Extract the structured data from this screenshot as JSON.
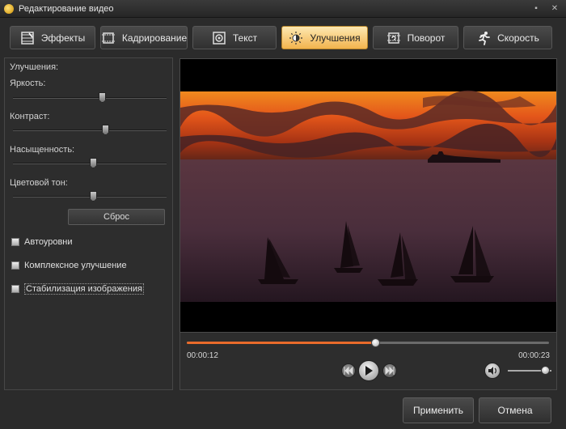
{
  "window": {
    "title": "Редактирование видео",
    "app_icon": "app-logo-icon"
  },
  "tabs": [
    {
      "label": "Эффекты",
      "icon": "effects-icon",
      "active": false
    },
    {
      "label": "Кадрирование",
      "icon": "crop-icon",
      "active": false
    },
    {
      "label": "Текст",
      "icon": "text-icon",
      "active": false
    },
    {
      "label": "Улучшения",
      "icon": "enhance-sun-icon",
      "active": true
    },
    {
      "label": "Поворот",
      "icon": "rotate-icon",
      "active": false
    },
    {
      "label": "Скорость",
      "icon": "running-man-icon",
      "active": false
    }
  ],
  "enhance": {
    "section_title": "Улучшения:",
    "sliders": [
      {
        "label": "Яркость:",
        "value": 0.58
      },
      {
        "label": "Контраст:",
        "value": 0.6
      },
      {
        "label": "Насыщенность:",
        "value": 0.52
      },
      {
        "label": "Цветовой тон:",
        "value": 0.52
      }
    ],
    "reset_label": "Сброс",
    "checkboxes": [
      {
        "label": "Автоуровни",
        "checked": false
      },
      {
        "label": "Комплексное улучшение",
        "checked": false
      },
      {
        "label": "Стабилизация изображения",
        "checked": false
      }
    ]
  },
  "player": {
    "current_time": "00:00:12",
    "total_time": "00:00:23",
    "progress": 0.52,
    "volume": 0.85
  },
  "buttons": {
    "apply": "Применить",
    "cancel": "Отмена"
  },
  "colors": {
    "accent": "#e96b2b",
    "active_tab": "#f2b44e"
  }
}
